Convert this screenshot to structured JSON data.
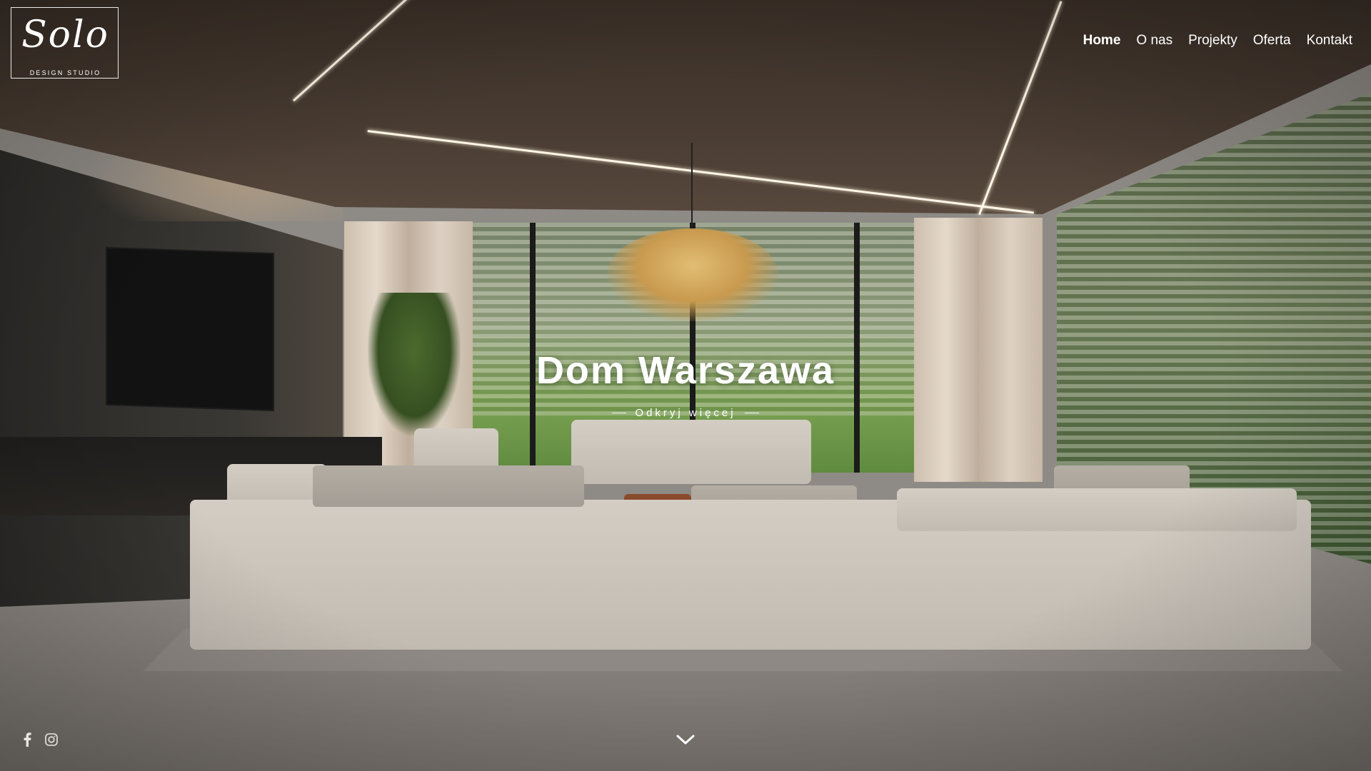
{
  "brand": {
    "logo_script": "Solo",
    "logo_subtitle": "DESIGN STUDIO"
  },
  "nav": {
    "items": [
      {
        "label": "Home",
        "active": true
      },
      {
        "label": "O nas",
        "active": false
      },
      {
        "label": "Projekty",
        "active": false
      },
      {
        "label": "Oferta",
        "active": false
      },
      {
        "label": "Kontakt",
        "active": false
      }
    ]
  },
  "hero": {
    "title": "Dom Warszawa",
    "cta_label": "Odkryj więcej"
  },
  "social": {
    "icons": [
      "facebook-icon",
      "instagram-icon"
    ]
  },
  "scroll": {
    "icon": "chevron-down-icon"
  },
  "colors": {
    "text": "#ffffff",
    "ceiling_wood": "#3a2f27",
    "sofa": "#c8c2b9",
    "ottoman": "#8a4a2c"
  }
}
